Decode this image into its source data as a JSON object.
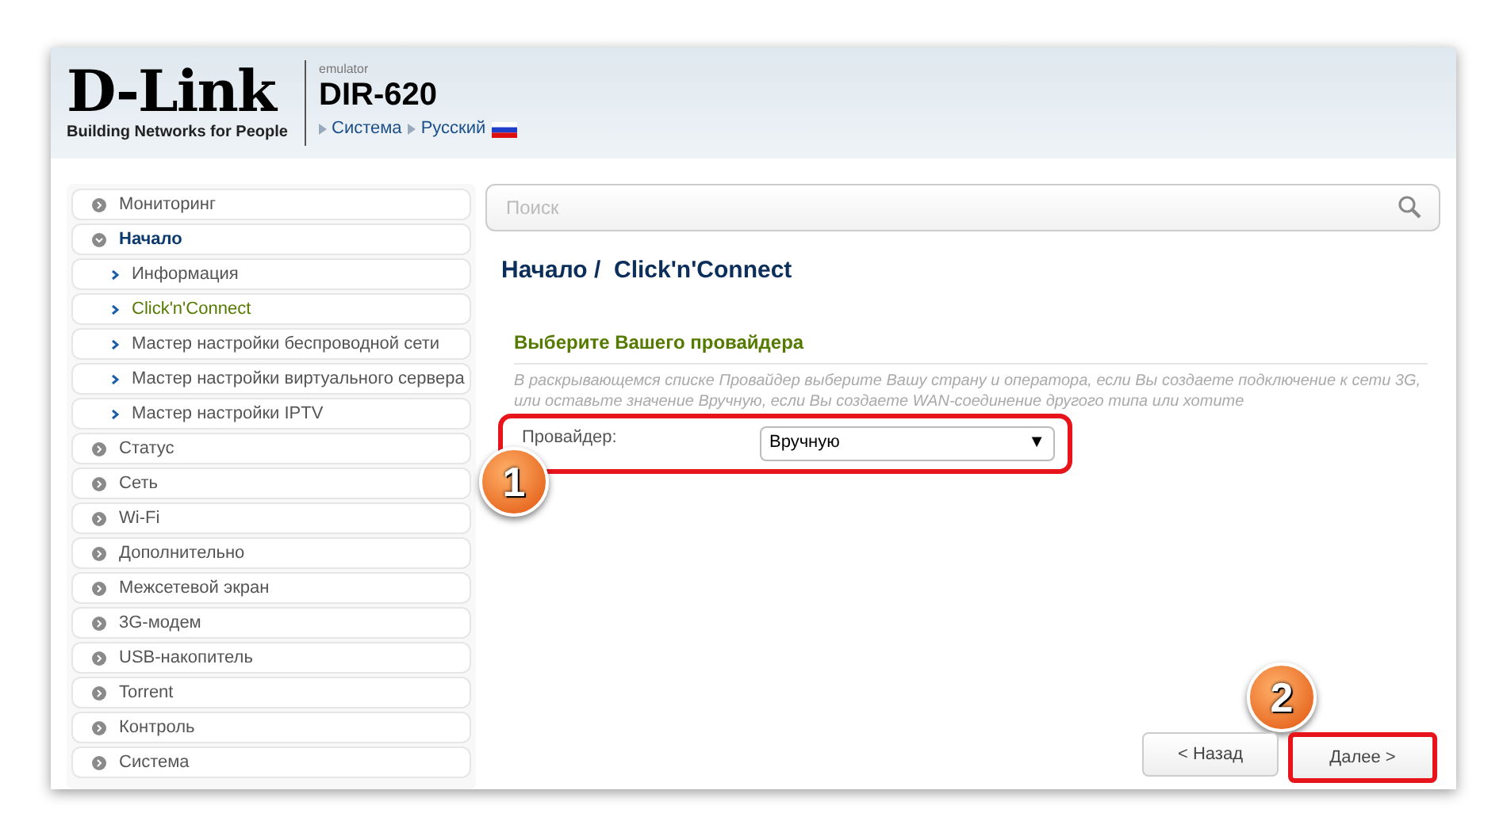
{
  "header": {
    "logo": "D-Link",
    "tagline": "Building Networks for People",
    "emulator": "emulator",
    "model": "DIR-620",
    "breadcrumb": [
      "Система",
      "Русский"
    ]
  },
  "sidebar": {
    "items": [
      {
        "label": "Мониторинг",
        "expanded": false,
        "selected": false
      },
      {
        "label": "Начало",
        "expanded": true,
        "selected": false,
        "children": [
          {
            "label": "Информация",
            "selected": false
          },
          {
            "label": "Click'n'Connect",
            "selected": true
          },
          {
            "label": "Мастер настройки беспроводной сети",
            "selected": false
          },
          {
            "label": "Мастер настройки виртуального сервера",
            "selected": false
          },
          {
            "label": "Мастер настройки IPTV",
            "selected": false
          }
        ]
      },
      {
        "label": "Статус",
        "expanded": false,
        "selected": false
      },
      {
        "label": "Сеть",
        "expanded": false,
        "selected": false
      },
      {
        "label": "Wi-Fi",
        "expanded": false,
        "selected": false
      },
      {
        "label": "Дополнительно",
        "expanded": false,
        "selected": false
      },
      {
        "label": "Межсетевой экран",
        "expanded": false,
        "selected": false
      },
      {
        "label": "3G-модем",
        "expanded": false,
        "selected": false
      },
      {
        "label": "USB-накопитель",
        "expanded": false,
        "selected": false
      },
      {
        "label": "Torrent",
        "expanded": false,
        "selected": false
      },
      {
        "label": "Контроль",
        "expanded": false,
        "selected": false
      },
      {
        "label": "Система",
        "expanded": false,
        "selected": false
      }
    ]
  },
  "search": {
    "placeholder": "Поиск"
  },
  "page_title": "Начало /  Click'n'Connect",
  "section": {
    "title": "Выберите Вашего провайдера",
    "description": "В раскрывающемся списке Провайдер выберите Вашу страну и оператора, если Вы создаете подключение к сети 3G, или оставьте значение Вручную, если Вы создаете WAN-соединение другого типа или хотите",
    "field_label": "Провайдер:",
    "field_value": "Вручную",
    "caret": "▼"
  },
  "buttons": [
    {
      "label": "< Назад",
      "highlighted": false
    },
    {
      "label": "Далее >",
      "highlighted": true
    }
  ],
  "callouts": [
    "1",
    "2"
  ]
}
